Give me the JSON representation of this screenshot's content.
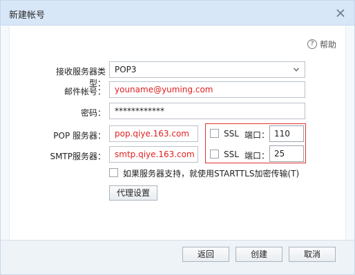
{
  "dialog": {
    "title": "新建帐号",
    "help_label": "帮助"
  },
  "form": {
    "protocol_label": "接收服务器类型：",
    "protocol_value": "POP3",
    "email_label": "邮件帐号：",
    "email_value": "youname@yuming.com",
    "password_label": "密码：",
    "password_value": "************",
    "pop_label": "POP 服务器：",
    "pop_value": "pop.qiye.163.com",
    "smtp_label": "SMTP服务器：",
    "smtp_value": "smtp.qiye.163.com",
    "pop_ssl_label": "SSL",
    "pop_port_label": "端口：",
    "pop_port_value": "110",
    "smtp_ssl_label": "SSL",
    "smtp_port_label": "端口：",
    "smtp_port_value": "25",
    "starttls_label": "如果服务器支持，就使用STARTTLS加密传输(T)",
    "proxy_button": "代理设置"
  },
  "footer": {
    "back_button": "返回",
    "create_button": "创建",
    "cancel_button": "取消"
  },
  "colors": {
    "error_text": "#e02020",
    "title_bar": "#d8e7f7",
    "highlight_border": "#e03030"
  },
  "icons": {
    "close": "close-icon",
    "help": "help-icon",
    "dropdown": "chevron-down-icon"
  }
}
